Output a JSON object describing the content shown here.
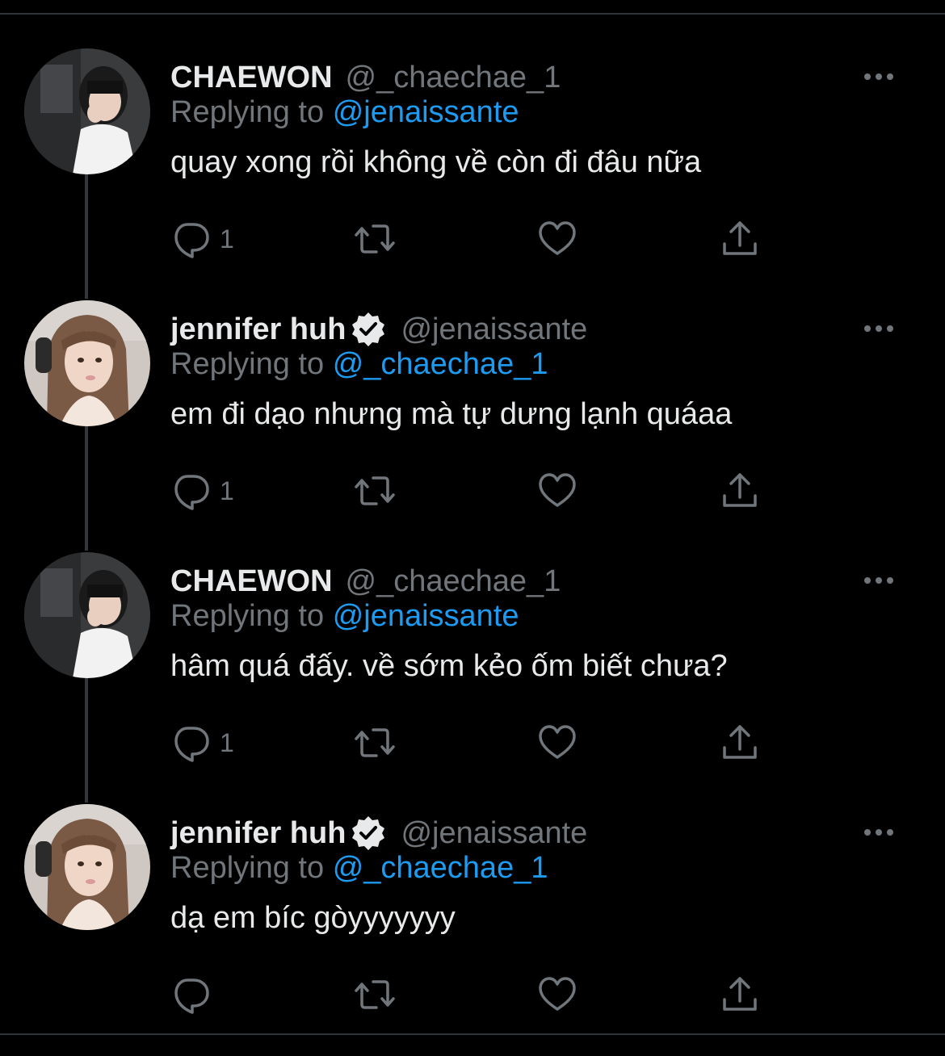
{
  "colors": {
    "background": "#000000",
    "text_primary": "#e7e9ea",
    "text_secondary": "#71767b",
    "link": "#1d9bf0",
    "divider": "#2f3336",
    "thread_line": "#333639"
  },
  "tweets": [
    {
      "display_name": "CHAEWON",
      "verified": false,
      "handle": "@_chaechae_1",
      "reply_prefix": "Replying to",
      "reply_target": "@jenaissante",
      "text": "quay xong rồi không về còn đi đâu nữa",
      "reply_count": "1",
      "avatar": "avatar-chaewon"
    },
    {
      "display_name": "jennifer huh",
      "verified": true,
      "handle": "@jenaissante",
      "reply_prefix": "Replying to",
      "reply_target": "@_chaechae_1",
      "text": "em đi dạo nhưng mà tự dưng lạnh quáaa",
      "reply_count": "1",
      "avatar": "avatar-jennifer"
    },
    {
      "display_name": "CHAEWON",
      "verified": false,
      "handle": "@_chaechae_1",
      "reply_prefix": "Replying to",
      "reply_target": "@jenaissante",
      "text": "hâm quá đấy. về sớm kẻo ốm biết chưa?",
      "reply_count": "1",
      "avatar": "avatar-chaewon"
    },
    {
      "display_name": "jennifer huh",
      "verified": true,
      "handle": "@jenaissante",
      "reply_prefix": "Replying to",
      "reply_target": "@_chaechae_1",
      "text": "dạ em bíc gòyyyyyyy",
      "reply_count": "",
      "avatar": "avatar-jennifer"
    }
  ],
  "icons": {
    "reply": "reply-icon",
    "retweet": "retweet-icon",
    "like": "heart-icon",
    "share": "share-icon",
    "more": "more-icon",
    "verified": "verified-badge-icon"
  }
}
